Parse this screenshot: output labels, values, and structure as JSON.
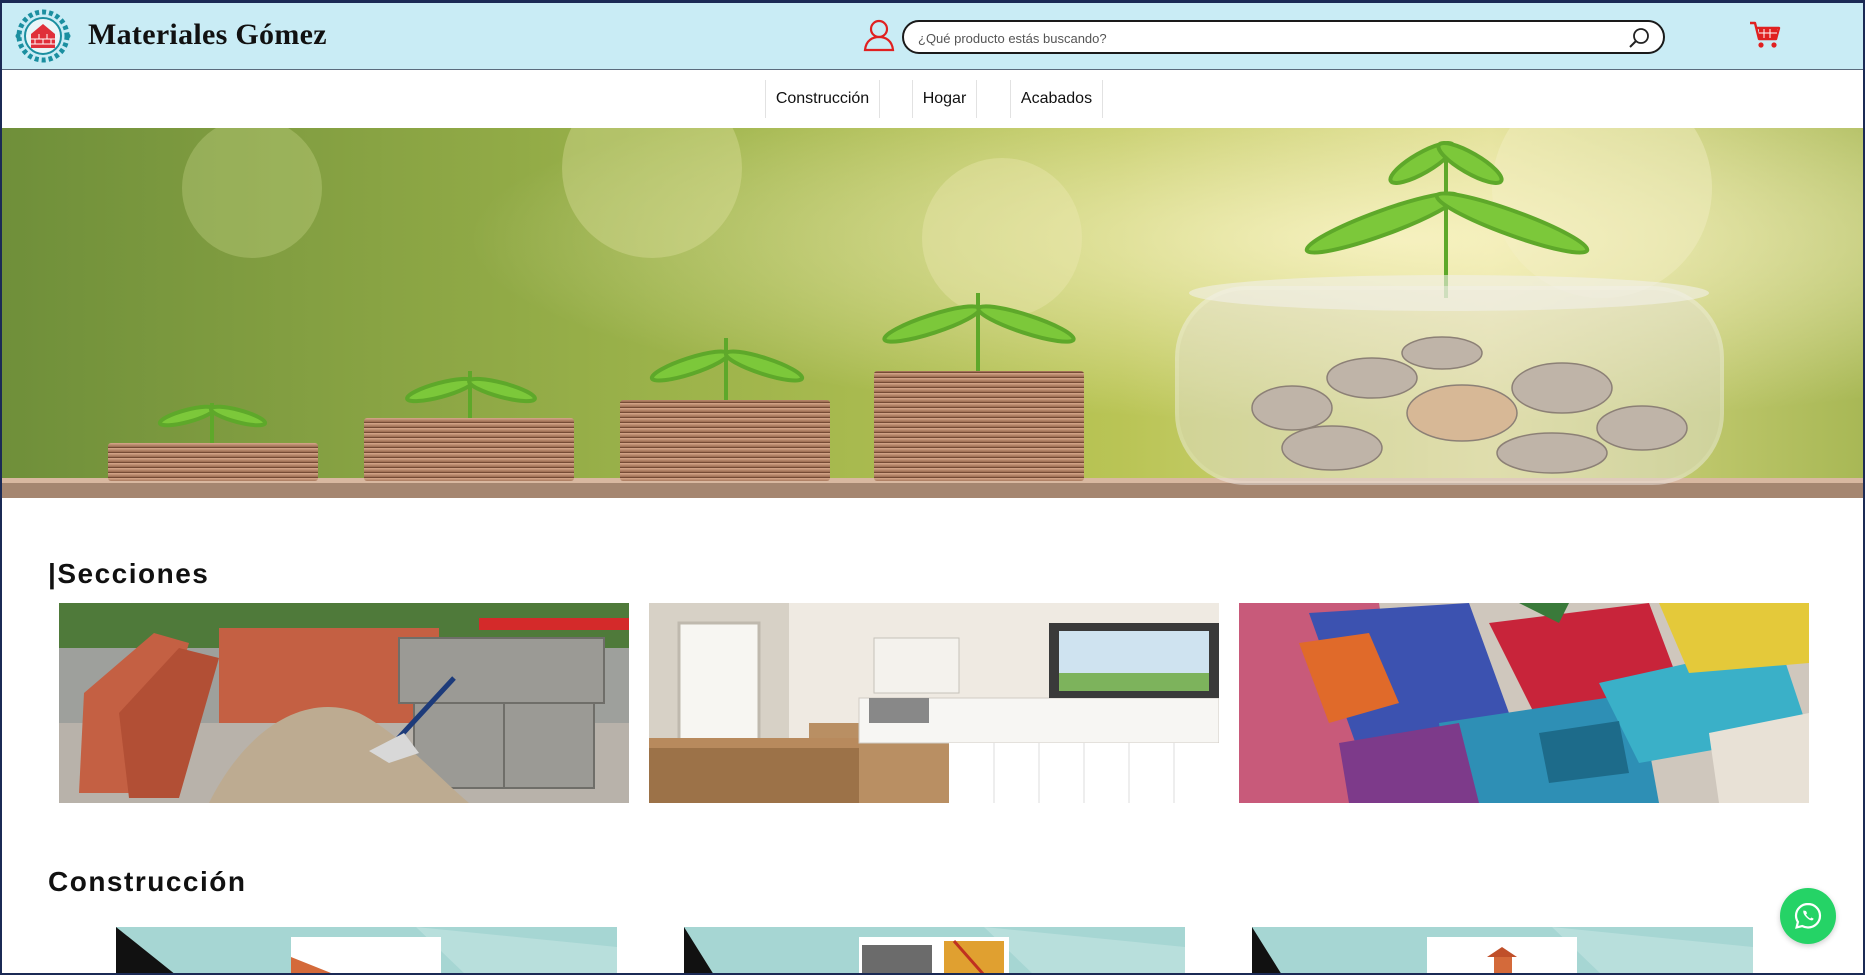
{
  "header": {
    "brand": "Materiales Gómez",
    "search_placeholder": "¿Qué producto estás buscando?",
    "icons": [
      "logo-icon",
      "user-icon",
      "search-icon",
      "cart-icon"
    ],
    "colors": {
      "header_bg": "#c9ecf5",
      "accent_red": "#e02020",
      "logo_teal": "#1b8fa0"
    }
  },
  "nav": {
    "items": [
      {
        "label": "Construcción"
      },
      {
        "label": "Hogar"
      },
      {
        "label": "Acabados"
      }
    ]
  },
  "sections": {
    "title": "|Secciones",
    "cards": [
      "construction-materials",
      "kitchen",
      "paint-brushes"
    ]
  },
  "construccion": {
    "title": "Construcción"
  },
  "floating": {
    "icon": "whatsapp-icon",
    "color": "#25d366"
  }
}
